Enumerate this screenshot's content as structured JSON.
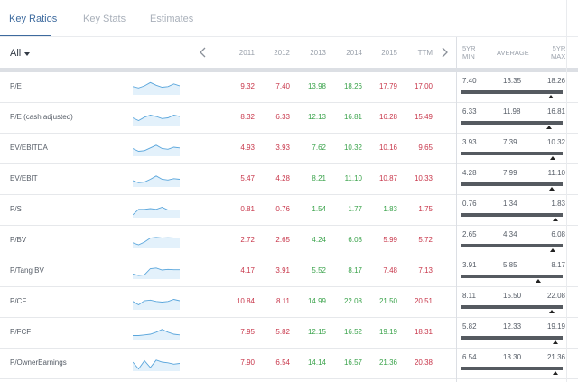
{
  "tabs": [
    {
      "label": "Key Ratios",
      "active": true
    },
    {
      "label": "Key Stats",
      "active": false
    },
    {
      "label": "Estimates",
      "active": false
    }
  ],
  "filter": {
    "label": "All"
  },
  "years": [
    "2011",
    "2012",
    "2013",
    "2014",
    "2015",
    "TTM"
  ],
  "summary_headers": {
    "min_line1": "5YR",
    "min_line2": "MIN",
    "average": "AVERAGE",
    "max_line1": "5YR",
    "max_line2": "MAX"
  },
  "colors": {
    "negative": "#c8374b",
    "positive": "#3aa34b",
    "accent": "#3d6a9e",
    "spark": "#5aa6dc"
  },
  "rows": [
    {
      "label": "P/E",
      "values": [
        "9.32",
        "7.40",
        "13.98",
        "18.26",
        "17.79",
        "17.00"
      ],
      "tone": [
        "red",
        "red",
        "green",
        "green",
        "red",
        "red"
      ],
      "min": "7.40",
      "avg": "13.35",
      "max": "18.26",
      "spark": [
        0.55,
        0.45,
        0.6,
        0.85,
        0.65,
        0.5,
        0.55,
        0.75,
        0.6
      ],
      "position": 0.88
    },
    {
      "label": "P/E (cash adjusted)",
      "values": [
        "8.32",
        "6.33",
        "12.13",
        "16.81",
        "16.28",
        "15.49"
      ],
      "tone": [
        "red",
        "red",
        "green",
        "green",
        "red",
        "red"
      ],
      "min": "6.33",
      "avg": "11.98",
      "max": "16.81",
      "spark": [
        0.5,
        0.3,
        0.55,
        0.7,
        0.6,
        0.45,
        0.5,
        0.7,
        0.6
      ],
      "position": 0.87
    },
    {
      "label": "EV/EBITDA",
      "values": [
        "4.93",
        "3.93",
        "7.62",
        "10.32",
        "10.16",
        "9.65"
      ],
      "tone": [
        "red",
        "red",
        "green",
        "green",
        "red",
        "red"
      ],
      "min": "3.93",
      "avg": "7.39",
      "max": "10.32",
      "spark": [
        0.5,
        0.3,
        0.35,
        0.55,
        0.75,
        0.5,
        0.45,
        0.6,
        0.55
      ],
      "position": 0.9
    },
    {
      "label": "EV/EBIT",
      "values": [
        "5.47",
        "4.28",
        "8.21",
        "11.10",
        "10.87",
        "10.33"
      ],
      "tone": [
        "red",
        "red",
        "green",
        "green",
        "red",
        "red"
      ],
      "min": "4.28",
      "avg": "7.99",
      "max": "11.10",
      "spark": [
        0.4,
        0.25,
        0.3,
        0.5,
        0.75,
        0.5,
        0.45,
        0.55,
        0.5
      ],
      "position": 0.89
    },
    {
      "label": "P/S",
      "values": [
        "0.81",
        "0.76",
        "1.54",
        "1.77",
        "1.83",
        "1.75"
      ],
      "tone": [
        "red",
        "red",
        "green",
        "green",
        "green",
        "red"
      ],
      "min": "0.76",
      "avg": "1.34",
      "max": "1.83",
      "spark": [
        0.15,
        0.55,
        0.55,
        0.6,
        0.55,
        0.7,
        0.5,
        0.5,
        0.5
      ],
      "position": 0.93
    },
    {
      "label": "P/BV",
      "values": [
        "2.72",
        "2.65",
        "4.24",
        "6.08",
        "5.99",
        "5.72"
      ],
      "tone": [
        "red",
        "red",
        "green",
        "green",
        "red",
        "red"
      ],
      "min": "2.65",
      "avg": "4.34",
      "max": "6.08",
      "spark": [
        0.35,
        0.2,
        0.4,
        0.7,
        0.75,
        0.7,
        0.72,
        0.7,
        0.7
      ],
      "position": 0.9
    },
    {
      "label": "P/Tang BV",
      "values": [
        "4.17",
        "3.91",
        "5.52",
        "8.17",
        "7.48",
        "7.13"
      ],
      "tone": [
        "red",
        "red",
        "green",
        "green",
        "red",
        "red"
      ],
      "min": "3.91",
      "avg": "5.85",
      "max": "8.17",
      "spark": [
        0.3,
        0.2,
        0.25,
        0.7,
        0.75,
        0.6,
        0.65,
        0.62,
        0.62
      ],
      "position": 0.76
    },
    {
      "label": "P/CF",
      "values": [
        "10.84",
        "8.11",
        "14.99",
        "22.08",
        "21.50",
        "20.51"
      ],
      "tone": [
        "red",
        "red",
        "green",
        "green",
        "green",
        "red"
      ],
      "min": "8.11",
      "avg": "15.50",
      "max": "22.08",
      "spark": [
        0.55,
        0.3,
        0.6,
        0.65,
        0.55,
        0.5,
        0.55,
        0.7,
        0.6
      ],
      "position": 0.89
    },
    {
      "label": "P/FCF",
      "values": [
        "7.95",
        "5.82",
        "12.15",
        "16.52",
        "19.19",
        "18.31"
      ],
      "tone": [
        "red",
        "red",
        "green",
        "green",
        "green",
        "red"
      ],
      "min": "5.82",
      "avg": "12.33",
      "max": "19.19",
      "spark": [
        0.3,
        0.3,
        0.35,
        0.4,
        0.55,
        0.75,
        0.55,
        0.4,
        0.35
      ],
      "position": 0.93
    },
    {
      "label": "P/OwnerEarnings",
      "values": [
        "7.90",
        "6.54",
        "14.14",
        "16.57",
        "21.36",
        "20.38"
      ],
      "tone": [
        "red",
        "red",
        "green",
        "green",
        "green",
        "red"
      ],
      "min": "6.54",
      "avg": "13.30",
      "max": "21.36",
      "spark": [
        0.6,
        0.1,
        0.7,
        0.2,
        0.75,
        0.6,
        0.55,
        0.45,
        0.5
      ],
      "position": 0.93
    }
  ]
}
